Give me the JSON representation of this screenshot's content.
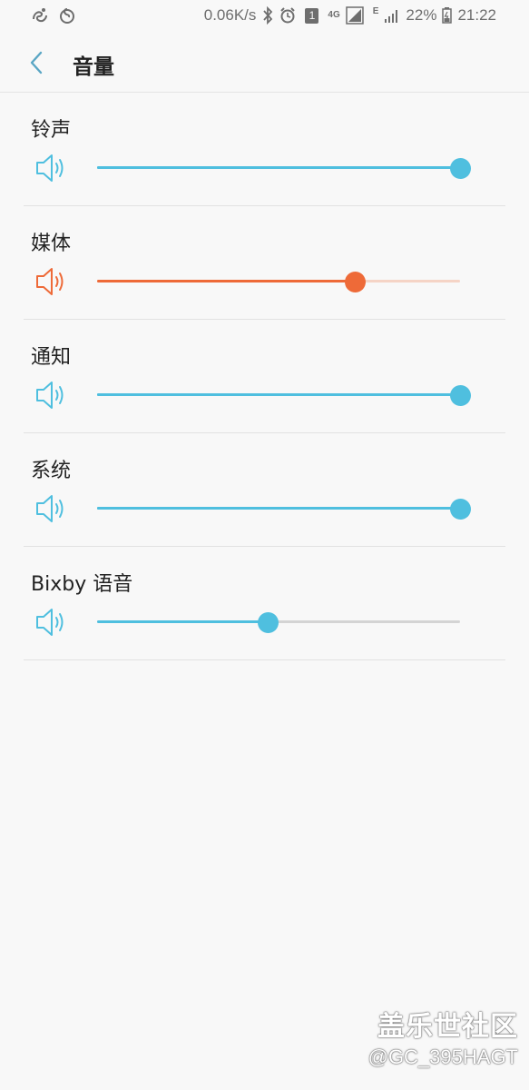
{
  "status_bar": {
    "net_speed": "0.06K/s",
    "network_type": "4G",
    "edge_label": "E",
    "battery": "22%",
    "time": "21:22",
    "sim_badge": "1",
    "icons": [
      "uc-browser-icon",
      "netease-music-icon",
      "bluetooth-icon",
      "alarm-icon",
      "sim-icon",
      "signal-icon",
      "battery-icon"
    ]
  },
  "header": {
    "title": "音量",
    "back_icon": "chevron-left-icon"
  },
  "volume_items": [
    {
      "label": "铃声",
      "level": 1.0,
      "color": "#4fbfdf",
      "track_color": "#4fbfdf",
      "icon": "speaker-icon"
    },
    {
      "label": "媒体",
      "level": 0.71,
      "color": "#ee6a38",
      "track_color": "#f5d4c6",
      "icon": "speaker-icon"
    },
    {
      "label": "通知",
      "level": 1.0,
      "color": "#4fbfdf",
      "track_color": "#4fbfdf",
      "icon": "speaker-icon"
    },
    {
      "label": "系统",
      "level": 1.0,
      "color": "#4fbfdf",
      "track_color": "#4fbfdf",
      "icon": "speaker-icon"
    },
    {
      "label": "Bixby 语音",
      "level": 0.47,
      "color": "#4fbfdf",
      "track_color": "#d4d4d4",
      "icon": "speaker-icon"
    }
  ],
  "watermark": {
    "title": "盖乐世社区",
    "handle": "@GC_395HAGT"
  }
}
